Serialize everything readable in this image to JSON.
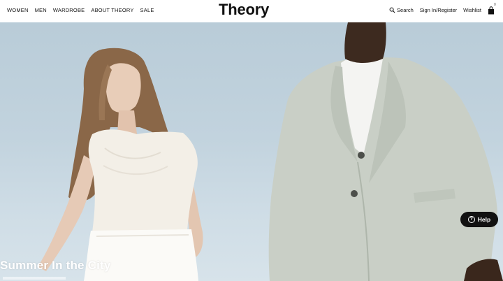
{
  "nav": {
    "items": [
      "WOMEN",
      "MEN",
      "WARDROBE",
      "ABOUT THEORY",
      "SALE"
    ]
  },
  "brand": {
    "logo": "Theory"
  },
  "utility": {
    "search_label": "Search",
    "account_label": "Sign In/Register",
    "wishlist_label": "Wishlist",
    "bag_count": "0"
  },
  "hero": {
    "headline": "Summer In the City"
  },
  "help": {
    "label": "Help",
    "icon_glyph": "?"
  },
  "colors": {
    "sky": "#c2d3de",
    "header_bg": "#ffffff",
    "help_bg": "#111111"
  }
}
